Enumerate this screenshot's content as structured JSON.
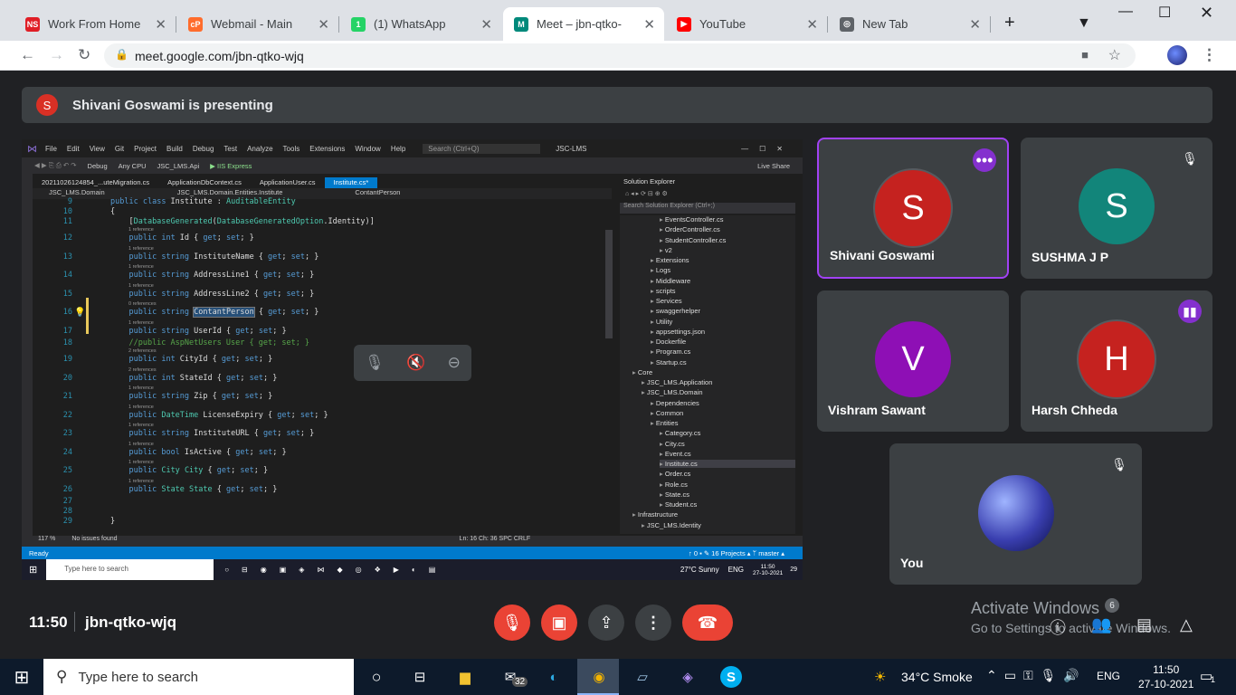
{
  "browser": {
    "tabs": [
      {
        "favicon": "NS",
        "title": "Work From Home",
        "color": "#e01e26"
      },
      {
        "favicon": "cP",
        "title": "Webmail - Main",
        "color": "#ff6c2c"
      },
      {
        "favicon": "1",
        "title": "(1) WhatsApp",
        "color": "#25d366"
      },
      {
        "favicon": "M",
        "title": "Meet – jbn-qtko-",
        "color": "#00897b"
      },
      {
        "favicon": "▶",
        "title": "YouTube",
        "color": "#ff0000"
      },
      {
        "favicon": "◎",
        "title": "New Tab",
        "color": "#5f6368"
      }
    ],
    "new_tab_label": "+",
    "url": "meet.google.com/jbn-qtko-wjq"
  },
  "meet": {
    "banner_avatar": "S",
    "banner_text": "Shivani Goswami is presenting",
    "time": "11:50",
    "meeting_code": "jbn-qtko-wjq",
    "participant_count": "6",
    "participants": [
      {
        "initial": "S",
        "name": "Shivani Goswami",
        "color": "#c5221f"
      },
      {
        "initial": "S",
        "name": "SUSHMA J P",
        "color": "#12857a"
      },
      {
        "initial": "V",
        "name": "Vishram Sawant",
        "color": "#8e0fb5"
      },
      {
        "initial": "H",
        "name": "Harsh Chheda",
        "color": "#c5221f"
      },
      {
        "initial": "",
        "name": "You",
        "color": "#3a3fb0"
      }
    ],
    "activate_title": "Activate Windows",
    "activate_sub": "Go to Settings to activate Windows."
  },
  "ide": {
    "menu": [
      "File",
      "Edit",
      "View",
      "Git",
      "Project",
      "Build",
      "Debug",
      "Test",
      "Analyze",
      "Tools",
      "Extensions",
      "Window",
      "Help"
    ],
    "search_placeholder": "Search (Ctrl+Q)",
    "solution_name": "JSC-LMS",
    "toolbar": [
      "Debug",
      "Any CPU",
      "JSC_LMS.Api",
      "▶ IIS Express",
      "Live Share"
    ],
    "tabs": [
      "20211026124854_...uteMigration.cs",
      "ApplicationDbContext.cs",
      "ApplicationUser.cs",
      "Institute.cs*"
    ],
    "nav": [
      "JSC_LMS.Domain",
      "JSC_LMS.Domain.Entities.Institute",
      "ContantPerson"
    ],
    "code_lines": [
      {
        "n": "9",
        "ref": "",
        "code": "public class Institute : AuditableEntity"
      },
      {
        "n": "10",
        "ref": "",
        "code": "{"
      },
      {
        "n": "11",
        "ref": "",
        "code": "    [DatabaseGenerated(DatabaseGeneratedOption.Identity)]"
      },
      {
        "n": "12",
        "ref": "1 reference",
        "code": "    public int Id { get; set; }"
      },
      {
        "n": "13",
        "ref": "1 reference",
        "code": "    public string InstituteName { get; set; }"
      },
      {
        "n": "14",
        "ref": "1 reference",
        "code": "    public string AddressLine1 { get; set; }"
      },
      {
        "n": "15",
        "ref": "1 reference",
        "code": "    public string AddressLine2 { get; set; }"
      },
      {
        "n": "16",
        "ref": "0 references",
        "code": "    public string ContantPerson { get; set; }"
      },
      {
        "n": "17",
        "ref": "1 reference",
        "code": "    public string UserId { get; set; }"
      },
      {
        "n": "18",
        "ref": "",
        "code": "    //public AspNetUsers User { get; set; }"
      },
      {
        "n": "19",
        "ref": "2 references",
        "code": "    public int CityId { get; set; }"
      },
      {
        "n": "20",
        "ref": "2 references",
        "code": "    public int StateId { get; set; }"
      },
      {
        "n": "21",
        "ref": "1 reference",
        "code": "    public string Zip { get; set; }"
      },
      {
        "n": "22",
        "ref": "1 reference",
        "code": "    public DateTime LicenseExpiry { get; set; }"
      },
      {
        "n": "23",
        "ref": "1 reference",
        "code": "    public string InstituteURL { get; set; }"
      },
      {
        "n": "24",
        "ref": "1 reference",
        "code": "    public bool IsActive { get; set; }"
      },
      {
        "n": "25",
        "ref": "1 reference",
        "code": "    public City City { get; set; }"
      },
      {
        "n": "26",
        "ref": "1 reference",
        "code": "    public State State { get; set; }"
      },
      {
        "n": "27",
        "ref": "",
        "code": ""
      },
      {
        "n": "28",
        "ref": "",
        "code": ""
      },
      {
        "n": "29",
        "ref": "",
        "code": "}"
      }
    ],
    "solution_explorer_title": "Solution Explorer",
    "solution_search": "Search Solution Explorer (Ctrl+;)",
    "tree": [
      {
        "d": 3,
        "t": "EventsController.cs"
      },
      {
        "d": 3,
        "t": "OrderController.cs"
      },
      {
        "d": 3,
        "t": "StudentController.cs"
      },
      {
        "d": 3,
        "t": "v2"
      },
      {
        "d": 2,
        "t": "Extensions"
      },
      {
        "d": 2,
        "t": "Logs"
      },
      {
        "d": 2,
        "t": "Middleware"
      },
      {
        "d": 2,
        "t": "scripts"
      },
      {
        "d": 2,
        "t": "Services"
      },
      {
        "d": 2,
        "t": "swaggerhelper"
      },
      {
        "d": 2,
        "t": "Utility"
      },
      {
        "d": 2,
        "t": "appsettings.json"
      },
      {
        "d": 2,
        "t": "Dockerfile"
      },
      {
        "d": 2,
        "t": "Program.cs"
      },
      {
        "d": 2,
        "t": "Startup.cs"
      },
      {
        "d": 0,
        "t": "Core"
      },
      {
        "d": 1,
        "t": "JSC_LMS.Application"
      },
      {
        "d": 1,
        "t": "JSC_LMS.Domain"
      },
      {
        "d": 2,
        "t": "Dependencies"
      },
      {
        "d": 2,
        "t": "Common"
      },
      {
        "d": 2,
        "t": "Entities"
      },
      {
        "d": 3,
        "t": "Category.cs"
      },
      {
        "d": 3,
        "t": "City.cs"
      },
      {
        "d": 3,
        "t": "Event.cs"
      },
      {
        "d": 3,
        "t": "Institute.cs"
      },
      {
        "d": 3,
        "t": "Order.cs"
      },
      {
        "d": 3,
        "t": "Role.cs"
      },
      {
        "d": 3,
        "t": "State.cs"
      },
      {
        "d": 3,
        "t": "Student.cs"
      },
      {
        "d": 0,
        "t": "Infrastructure"
      },
      {
        "d": 1,
        "t": "JSC_LMS.Identity"
      }
    ],
    "zoom": "117 %",
    "issues": "No issues found",
    "cursor": "Ln: 16   Ch: 36   SPC   CRLF",
    "status_ready": "Ready",
    "status_right": "↑ 0 ▪   ✎ 16   Projects ▴   ᛘ master ▴",
    "inner_search": "Type here to search",
    "inner_weather": "27°C  Sunny",
    "inner_lang": "ENG",
    "inner_time": "11:50",
    "inner_date": "27-10-2021",
    "inner_badge": "29"
  },
  "taskbar": {
    "search_placeholder": "Type here to search",
    "mail_badge": "32",
    "weather": "34°C  Smoke",
    "lang": "ENG",
    "time": "11:50",
    "date": "27-10-2021",
    "notif": "1"
  }
}
